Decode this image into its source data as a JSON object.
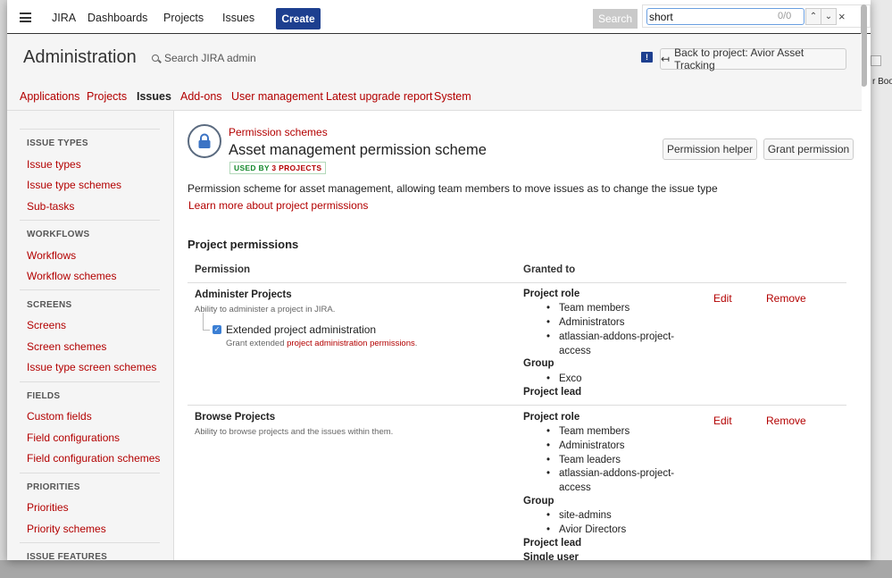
{
  "topnav": {
    "brand": "JIRA",
    "items": [
      "Dashboards",
      "Projects",
      "Issues"
    ],
    "create": "Create",
    "search_button": "Search"
  },
  "findbar": {
    "query": "short",
    "count": "0/0"
  },
  "background": {
    "right_text": "r Boo"
  },
  "admin": {
    "title": "Administration",
    "search_placeholder": "Search JIRA admin",
    "back_button": "Back to project: Avior Asset Tracking"
  },
  "tabs": [
    "Applications",
    "Projects",
    "Issues",
    "Add-ons",
    "User management",
    "Latest upgrade report",
    "System"
  ],
  "sidebar": {
    "issue_types": {
      "title": "ISSUE TYPES",
      "items": [
        "Issue types",
        "Issue type schemes",
        "Sub-tasks"
      ]
    },
    "workflows": {
      "title": "WORKFLOWS",
      "items": [
        "Workflows",
        "Workflow schemes"
      ]
    },
    "screens": {
      "title": "SCREENS",
      "items": [
        "Screens",
        "Screen schemes",
        "Issue type screen schemes"
      ]
    },
    "fields": {
      "title": "FIELDS",
      "items": [
        "Custom fields",
        "Field configurations",
        "Field configuration schemes"
      ]
    },
    "priorities": {
      "title": "PRIORITIES",
      "items": [
        "Priorities",
        "Priority schemes"
      ]
    },
    "issue_features": {
      "title": "ISSUE FEATURES"
    }
  },
  "scheme": {
    "breadcrumb": "Permission schemes",
    "title": "Asset management permission scheme",
    "badge_prefix": "USED BY",
    "badge_count": "3 PROJECTS",
    "helper_button": "Permission helper",
    "grant_button": "Grant permission",
    "description": "Permission scheme for asset management, allowing team members to move issues as to change the issue type",
    "learn_more": "Learn more about project permissions"
  },
  "permissions": {
    "section_title": "Project permissions",
    "col_permission": "Permission",
    "col_granted": "Granted to",
    "edit": "Edit",
    "remove": "Remove",
    "administer": {
      "name": "Administer Projects",
      "desc": "Ability to administer a project in JIRA.",
      "sub_name": "Extended project administration",
      "sub_desc_prefix": "Grant extended",
      "sub_desc_link": "project administration permissions",
      "sub_desc_suffix": ".",
      "role_head": "Project role",
      "roles": [
        "Team members",
        "Administrators",
        "atlassian-addons-project-access"
      ],
      "group_head": "Group",
      "groups": [
        "Exco"
      ],
      "lead_head": "Project lead"
    },
    "browse": {
      "name": "Browse Projects",
      "desc": "Ability to browse projects and the issues within them.",
      "role_head": "Project role",
      "roles": [
        "Team members",
        "Administrators",
        "Team leaders",
        "atlassian-addons-project-access"
      ],
      "group_head": "Group",
      "groups": [
        "site-admins",
        "Avior Directors"
      ],
      "lead_head": "Project lead",
      "single_user_head": "Single user"
    }
  },
  "colors": {
    "brand": "#1d3f8f",
    "link": "#b30000",
    "badge_green": "#14892c"
  }
}
